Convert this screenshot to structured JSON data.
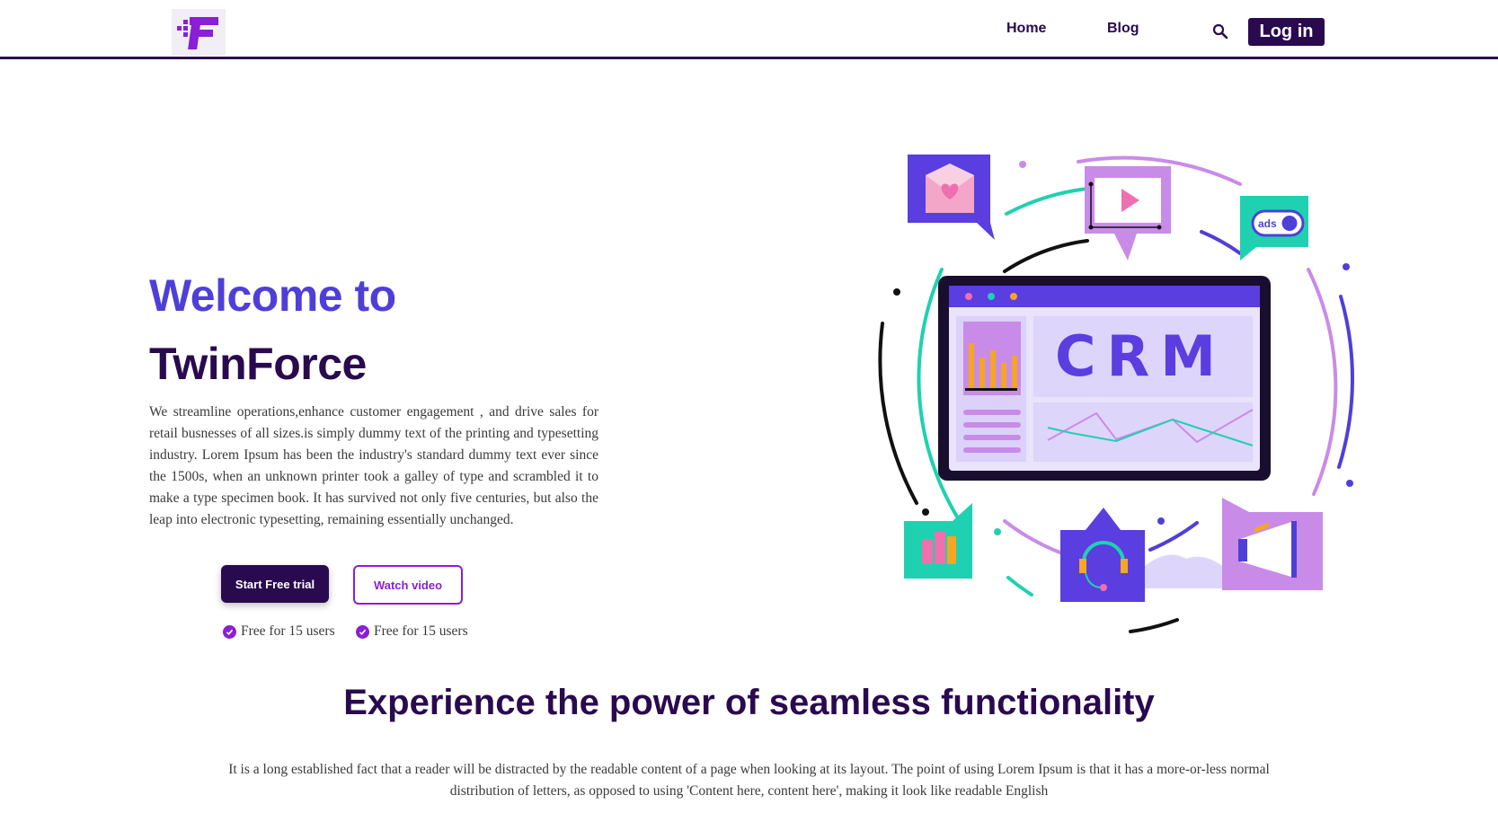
{
  "header": {
    "nav": {
      "home": "Home",
      "blog": "Blog"
    },
    "login_label": "Log in"
  },
  "hero": {
    "title_line1": "Welcome to",
    "title_line2": "TwinForce",
    "description": "We streamline operations,enhance customer engagement , and drive sales for retail busnesses of all sizes.is simply dummy text of the printing and typesetting industry. Lorem Ipsum has been the industry's standard dummy text ever since the 1500s, when an unknown printer took a galley of type and scrambled it to make a type specimen book. It has survived not only five centuries, but also the leap into electronic typesetting, remaining essentially unchanged.",
    "trial_button": "Start Free trial",
    "video_button": "Watch video",
    "perks": [
      "Free for 15 users",
      "Free for 15 users"
    ]
  },
  "illustration": {
    "screen_text": "CRM",
    "ads_label": "ads"
  },
  "section": {
    "title": "Experience the power of seamless functionality",
    "description": "It is a long established fact that a reader will be distracted by the readable content of a page when looking at its layout. The point of using Lorem Ipsum is that it has a more-or-less normal distribution of letters, as opposed to using 'Content here, content here', making it look like readable English"
  },
  "colors": {
    "brand_dark": "#2a0a4f",
    "brand_blue": "#4f3fd9",
    "accent_purple": "#8a1fd6",
    "teal": "#1fd1b0",
    "lavender": "#c98be8",
    "pink": "#f06fae",
    "orange": "#f5a623"
  }
}
